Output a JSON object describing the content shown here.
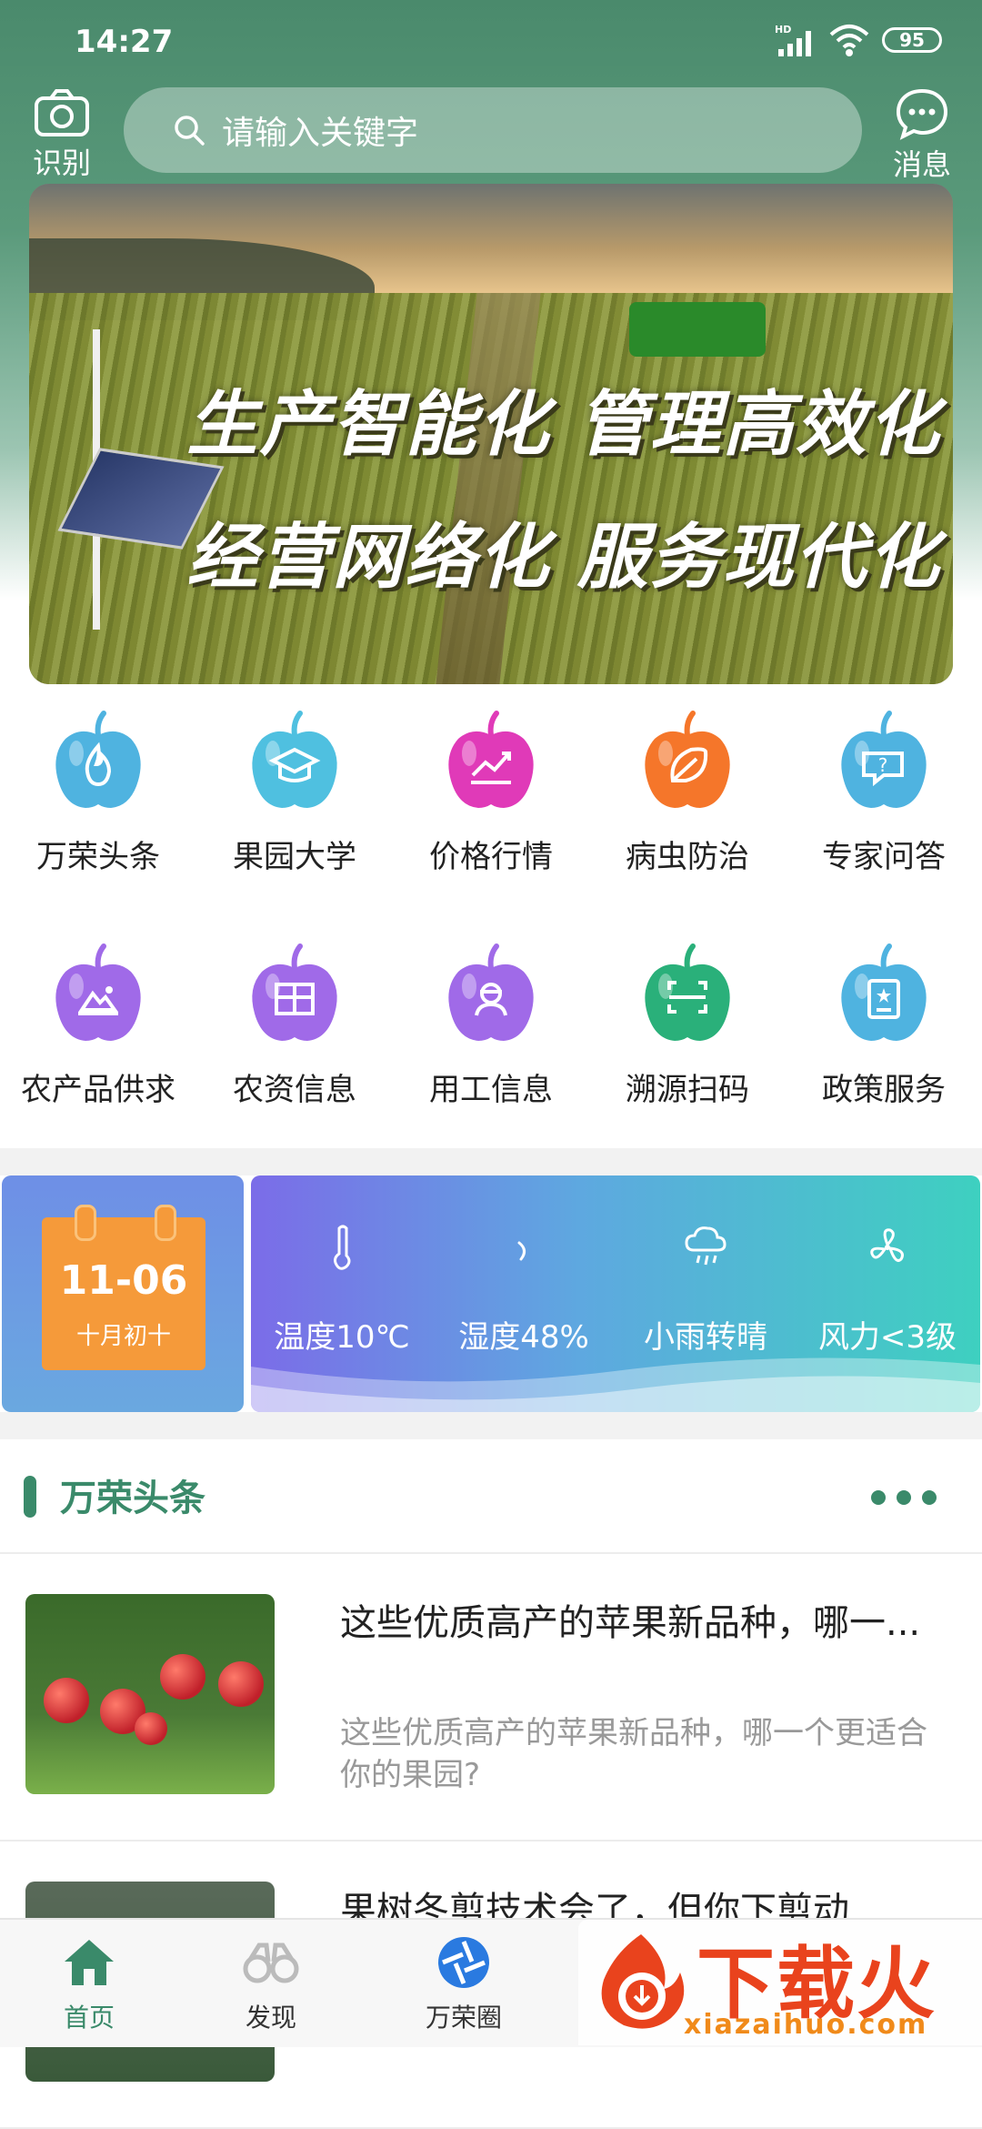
{
  "status_bar": {
    "time": "14:27",
    "network": "HD",
    "battery": "95"
  },
  "top_bar": {
    "scan_label": "识别",
    "search_placeholder": "请输入关键字",
    "message_label": "消息"
  },
  "banner": {
    "slogan_line1": "生产智能化 管理高效化",
    "slogan_line2": "经营网络化 服务现代化",
    "page_count": 3,
    "active_page": 3
  },
  "menu": [
    {
      "label": "万荣头条",
      "icon": "flame-icon",
      "color": "#4fb3e0"
    },
    {
      "label": "果园大学",
      "icon": "graduation-cap-icon",
      "color": "#4fc0e0"
    },
    {
      "label": "价格行情",
      "icon": "trend-chart-icon",
      "color": "#e03ab8"
    },
    {
      "label": "病虫防治",
      "icon": "leaf-icon",
      "color": "#f5762a"
    },
    {
      "label": "专家问答",
      "icon": "question-chat-icon",
      "color": "#4fb3e0"
    },
    {
      "label": "农产品供求",
      "icon": "landscape-icon",
      "color": "#a06ae8"
    },
    {
      "label": "农资信息",
      "icon": "grid-box-icon",
      "color": "#a06ae8"
    },
    {
      "label": "用工信息",
      "icon": "worker-icon",
      "color": "#a06ae8"
    },
    {
      "label": "溯源扫码",
      "icon": "scan-code-icon",
      "color": "#2ab07a"
    },
    {
      "label": "政策服务",
      "icon": "document-star-icon",
      "color": "#4fb3e0"
    }
  ],
  "calendar": {
    "date": "11-06",
    "lunar": "十月初十"
  },
  "weather": {
    "temperature": "温度10℃",
    "humidity": "湿度48%",
    "condition": "小雨转晴",
    "wind": "风力<3级"
  },
  "section": {
    "title": "万荣头条"
  },
  "news": [
    {
      "headline": "这些优质高产的苹果新品种，哪一...",
      "description": "这些优质高产的苹果新品种，哪一个更适合你的果园?"
    },
    {
      "headline": "果树冬剪技术会了，但你下剪动",
      "description": ""
    }
  ],
  "tabbar": [
    {
      "label": "首页",
      "icon": "home-icon",
      "active": true
    },
    {
      "label": "发现",
      "icon": "binoculars-icon",
      "active": false
    },
    {
      "label": "万荣圈",
      "icon": "aperture-icon",
      "active": false
    }
  ],
  "watermark": {
    "title": "下载火",
    "url": "xiazaihuo.com"
  },
  "colors": {
    "brand_green": "#3a8a6a",
    "header_green": "#4a8a6c"
  }
}
